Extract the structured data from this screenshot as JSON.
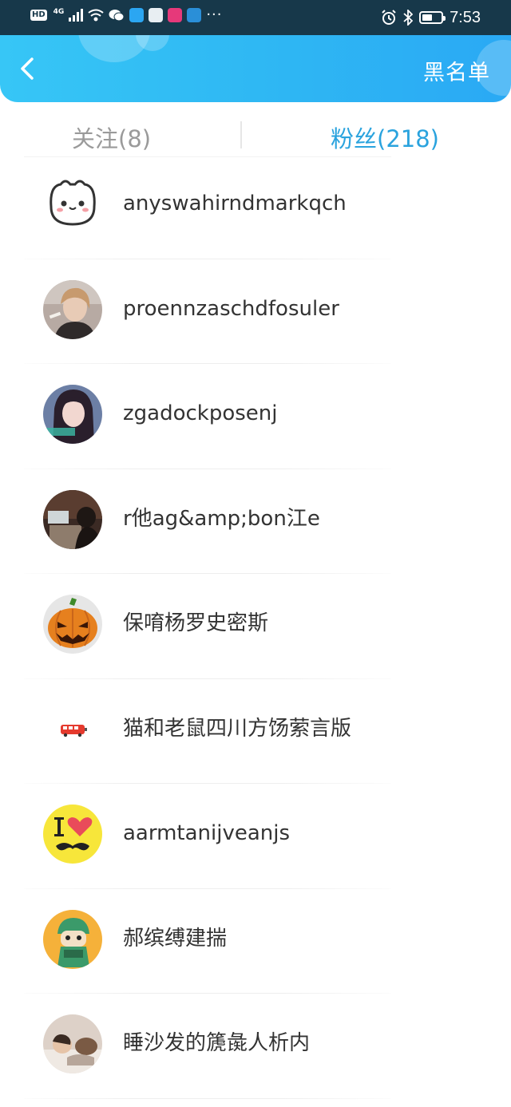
{
  "status_bar": {
    "hd_label": "HD",
    "network_label": "4G",
    "time": "7:53",
    "more": "···",
    "icons": [
      "hd-icon",
      "signal-icon",
      "wifi-icon",
      "wechat-icon",
      "search-app-icon",
      "huawei-app-icon",
      "shopping-app-icon",
      "weather-app-icon",
      "alarm-icon",
      "bluetooth-icon",
      "battery-icon"
    ]
  },
  "header": {
    "back_icon": "chevron-left-icon",
    "blacklist_label": "黑名单",
    "gradient_start": "#37c6f6",
    "gradient_end": "#2aa9f4"
  },
  "tabs": [
    {
      "label": "关注(8)",
      "active": false
    },
    {
      "label": "粉丝(218)",
      "active": true
    }
  ],
  "colors": {
    "active_tab": "#2aa3de",
    "inactive_tab": "#9a9a9a",
    "username": "#333333"
  },
  "fans": [
    {
      "name": "anyswahirndmarkqch",
      "avatar": "cartoon-cat"
    },
    {
      "name": "proennzaschdfosuler",
      "avatar": "photo-person"
    },
    {
      "name": "zgadockposenj",
      "avatar": "photo-girl"
    },
    {
      "name": "r他ag&amp;bon江e",
      "avatar": "photo-room"
    },
    {
      "name": "保唷杨罗史密斯",
      "avatar": "pumpkin"
    },
    {
      "name": "猫和老鼠四川方饧萦言版",
      "avatar": "red-bus"
    },
    {
      "name": "aarmtanijveanjs",
      "avatar": "i-heart-mustache"
    },
    {
      "name": "郝缤缚建揣",
      "avatar": "cartoon-character"
    },
    {
      "name": "睡沙发的篪彘人析内",
      "avatar": "photo-sleeping"
    }
  ]
}
